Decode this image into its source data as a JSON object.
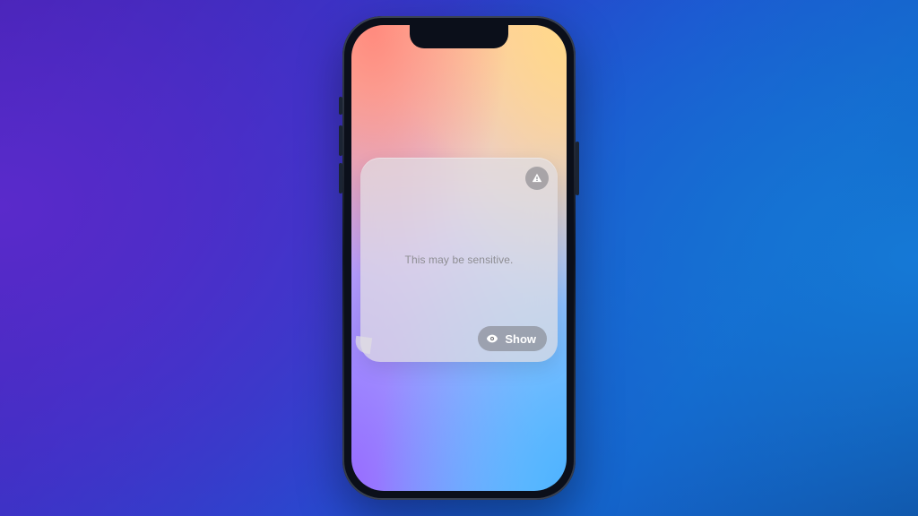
{
  "card": {
    "message": "This may be sensitive.",
    "show_label": "Show"
  },
  "icons": {
    "warning": "warning-triangle-icon",
    "eye": "eye-icon"
  },
  "colors": {
    "overlay_gray": "#8e8e93",
    "pill_bg": "rgba(120,120,128,.55)"
  }
}
